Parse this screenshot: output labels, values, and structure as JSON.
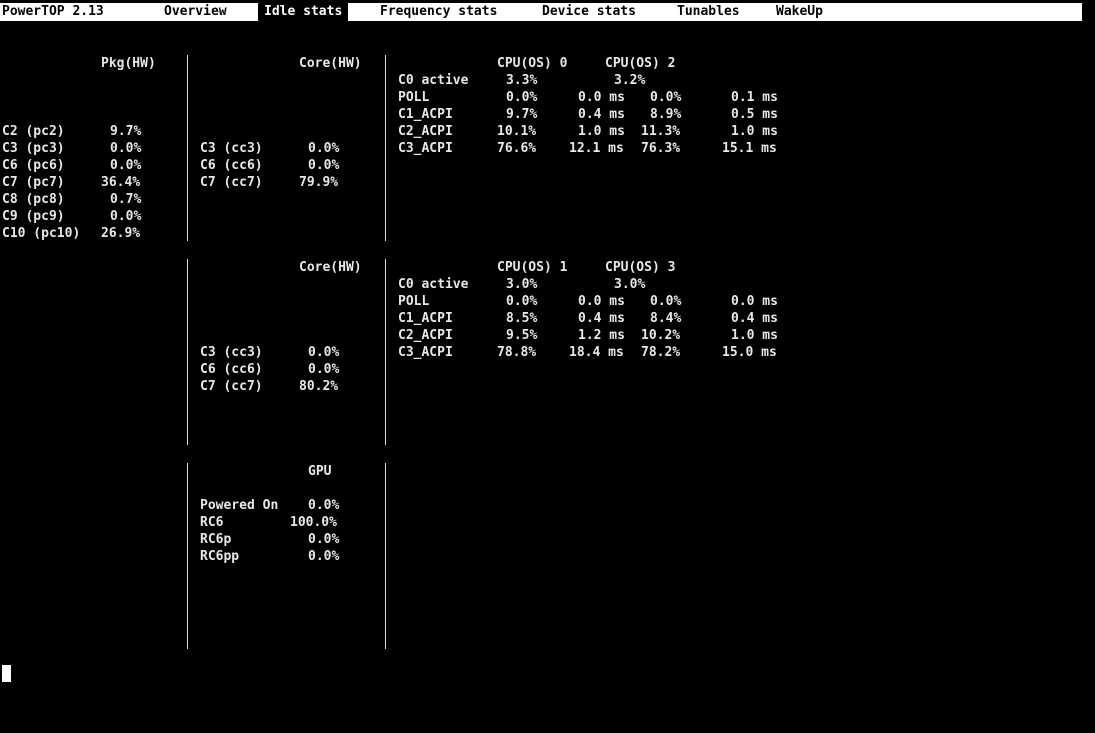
{
  "app": {
    "title": "PowerTOP 2.13"
  },
  "tabs": [
    {
      "label": "Overview",
      "active": false
    },
    {
      "label": "Idle stats",
      "active": true
    },
    {
      "label": "Frequency stats",
      "active": false
    },
    {
      "label": "Device stats",
      "active": false
    },
    {
      "label": "Tunables",
      "active": false
    },
    {
      "label": "WakeUp",
      "active": false
    }
  ],
  "pkg": {
    "header": "Pkg(HW)",
    "rows": [
      {
        "label": "C2 (pc2)",
        "value": "9.7%"
      },
      {
        "label": "C3 (pc3)",
        "value": "0.0%"
      },
      {
        "label": "C6 (pc6)",
        "value": "0.0%"
      },
      {
        "label": "C7 (pc7)",
        "value": "36.4%"
      },
      {
        "label": "C8 (pc8)",
        "value": "0.7%"
      },
      {
        "label": "C9 (pc9)",
        "value": "0.0%"
      },
      {
        "label": "C10 (pc10)",
        "value": "26.9%"
      }
    ]
  },
  "core_blocks": [
    {
      "header": "Core(HW)",
      "rows": [
        {
          "label": "C3 (cc3)",
          "value": "0.0%"
        },
        {
          "label": "C6 (cc6)",
          "value": "0.0%"
        },
        {
          "label": "C7 (cc7)",
          "value": "79.9%"
        }
      ]
    },
    {
      "header": "Core(HW)",
      "rows": [
        {
          "label": "C3 (cc3)",
          "value": "0.0%"
        },
        {
          "label": "C6 (cc6)",
          "value": "0.0%"
        },
        {
          "label": "C7 (cc7)",
          "value": "80.2%"
        }
      ]
    }
  ],
  "cpu_blocks": [
    {
      "header_a": "CPU(OS) 0",
      "header_b": "CPU(OS) 2",
      "rows": [
        {
          "label": "C0 active",
          "pct_a": "3.3%",
          "time_a": "",
          "pct_b": "3.2%",
          "time_b": ""
        },
        {
          "label": "POLL",
          "pct_a": "0.0%",
          "time_a": "0.0 ms",
          "pct_b": "0.0%",
          "time_b": "0.1 ms"
        },
        {
          "label": "C1_ACPI",
          "pct_a": "9.7%",
          "time_a": "0.4 ms",
          "pct_b": "8.9%",
          "time_b": "0.5 ms"
        },
        {
          "label": "C2_ACPI",
          "pct_a": "10.1%",
          "time_a": "1.0 ms",
          "pct_b": "11.3%",
          "time_b": "1.0 ms"
        },
        {
          "label": "C3_ACPI",
          "pct_a": "76.6%",
          "time_a": "12.1 ms",
          "pct_b": "76.3%",
          "time_b": "15.1 ms"
        }
      ]
    },
    {
      "header_a": "CPU(OS) 1",
      "header_b": "CPU(OS) 3",
      "rows": [
        {
          "label": "C0 active",
          "pct_a": "3.0%",
          "time_a": "",
          "pct_b": "3.0%",
          "time_b": ""
        },
        {
          "label": "POLL",
          "pct_a": "0.0%",
          "time_a": "0.0 ms",
          "pct_b": "0.0%",
          "time_b": "0.0 ms"
        },
        {
          "label": "C1_ACPI",
          "pct_a": "8.5%",
          "time_a": "0.4 ms",
          "pct_b": "8.4%",
          "time_b": "0.4 ms"
        },
        {
          "label": "C2_ACPI",
          "pct_a": "9.5%",
          "time_a": "1.2 ms",
          "pct_b": "10.2%",
          "time_b": "1.0 ms"
        },
        {
          "label": "C3_ACPI",
          "pct_a": "78.8%",
          "time_a": "18.4 ms",
          "pct_b": "78.2%",
          "time_b": "15.0 ms"
        }
      ]
    }
  ],
  "gpu": {
    "header": "GPU",
    "rows": [
      {
        "label": "Powered On",
        "value": "0.0%"
      },
      {
        "label": "RC6",
        "value": "100.0%"
      },
      {
        "label": "RC6p",
        "value": "0.0%"
      },
      {
        "label": "RC6pp",
        "value": "0.0%"
      }
    ]
  },
  "colors": {
    "background": "#000000",
    "foreground": "#e8e8e8",
    "bar": "#ffffff"
  }
}
